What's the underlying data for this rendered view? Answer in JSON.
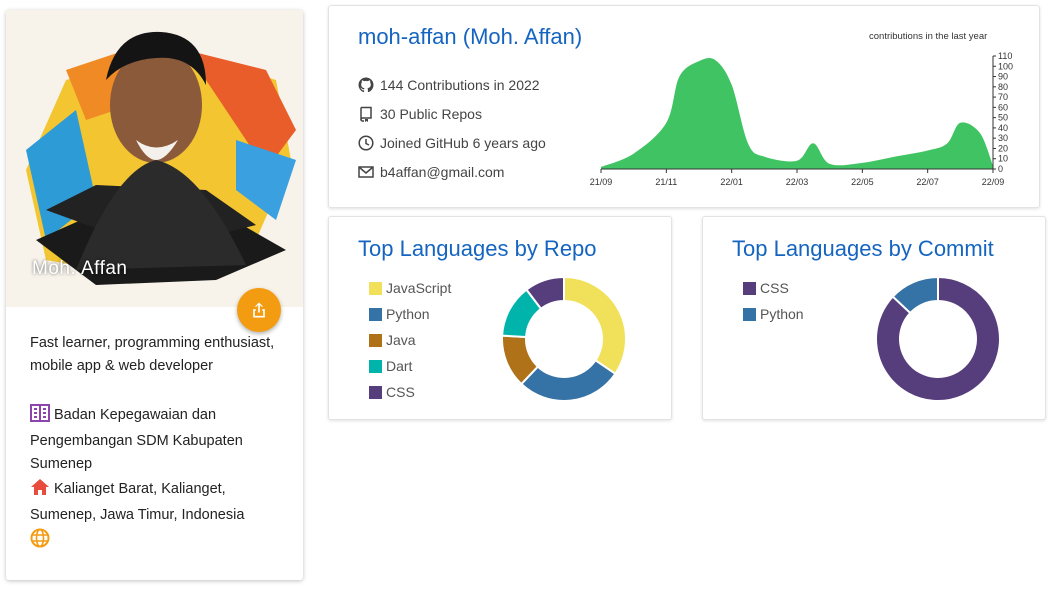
{
  "profile": {
    "photo_caption": "Moh. Affan",
    "bio": "Fast learner, programming enthusiast, mobile app & web developer",
    "organization": "Badan Kepegawaian dan Pengembangan SDM Kabupaten Sumenep",
    "location": "Kalianget Barat, Kalianget, Sumenep, Jawa Timur, Indonesia",
    "share_icon": "share-icon",
    "org_icon": "building-icon",
    "location_icon": "home-icon",
    "website_icon": "globe-icon",
    "colors": {
      "share": "#f39c12",
      "org_icon": "#8e44ad",
      "home_icon": "#e74c3c",
      "globe_icon": "#f39c12"
    }
  },
  "summary": {
    "title": "moh-affan (Moh. Affan)",
    "stats": [
      {
        "icon": "github-icon",
        "text": "144 Contributions in 2022"
      },
      {
        "icon": "repo-icon",
        "text": "30 Public Repos"
      },
      {
        "icon": "clock-icon",
        "text": "Joined GitHub 6 years ago"
      },
      {
        "icon": "mail-icon",
        "text": "b4affan@gmail.com"
      }
    ],
    "chart_label": "contributions in the last year"
  },
  "chart_data": [
    {
      "type": "area",
      "title": "contributions in the last year",
      "x_ticks": [
        "21/09",
        "21/11",
        "22/01",
        "22/03",
        "22/05",
        "22/07",
        "22/09"
      ],
      "y_ticks": [
        0,
        10,
        20,
        30,
        40,
        50,
        60,
        70,
        80,
        90,
        100,
        110
      ],
      "ylim": [
        0,
        110
      ],
      "x_months": [
        0,
        1,
        2,
        2.4,
        3,
        3.5,
        4,
        4.5,
        5,
        6,
        6.5,
        7,
        8,
        9,
        10,
        10.6,
        11,
        11.6,
        12
      ],
      "values": [
        2,
        15,
        45,
        90,
        105,
        106,
        82,
        25,
        12,
        8,
        25,
        5,
        6,
        12,
        18,
        25,
        45,
        35,
        3
      ],
      "color": "#40c463"
    },
    {
      "type": "pie",
      "title": "Top Languages by Repo",
      "labels": [
        "JavaScript",
        "Python",
        "Java",
        "Dart",
        "CSS"
      ],
      "values": [
        10,
        8,
        4,
        4,
        3
      ],
      "colors": [
        "#f1e05a",
        "#3572A5",
        "#b07219",
        "#00B4AB",
        "#563d7c"
      ]
    },
    {
      "type": "pie",
      "title": "Top Languages by Commit",
      "labels": [
        "CSS",
        "Python"
      ],
      "values": [
        87,
        13
      ],
      "colors": [
        "#563d7c",
        "#3572A5"
      ]
    }
  ]
}
